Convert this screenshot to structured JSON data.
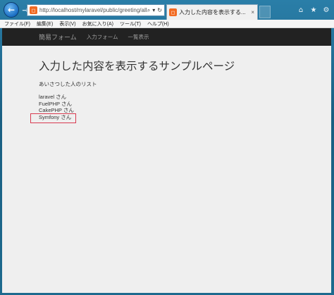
{
  "browser": {
    "address_url": "http://localhost/mylaravel/public/greeting/all",
    "tab_title": "入力した内容を表示する...",
    "tab_close": "×",
    "menu": [
      "ファイル(F)",
      "編集(E)",
      "表示(V)",
      "お気に入り(A)",
      "ツール(T)",
      "ヘルプ(H)"
    ],
    "icons": [
      "back-arrow-icon",
      "forward-arrow-icon",
      "search-icon",
      "refresh-icon",
      "home-icon",
      "star-icon",
      "gear-icon"
    ]
  },
  "site_nav": {
    "brand": "簡易フォーム",
    "links": [
      "入力フォーム",
      "一覧表示"
    ]
  },
  "main": {
    "title": "入力した内容を表示するサンプルページ",
    "subtitle": "あいさつした人のリスト",
    "items": [
      "laravel さん",
      "FuelPHP さん",
      "CakePHP さん",
      "Symfony さん"
    ],
    "highlighted_index": 3
  },
  "colors": {
    "navbar": "#222222",
    "highlight_border": "#d83a4f",
    "page_bg": "#efefef"
  }
}
